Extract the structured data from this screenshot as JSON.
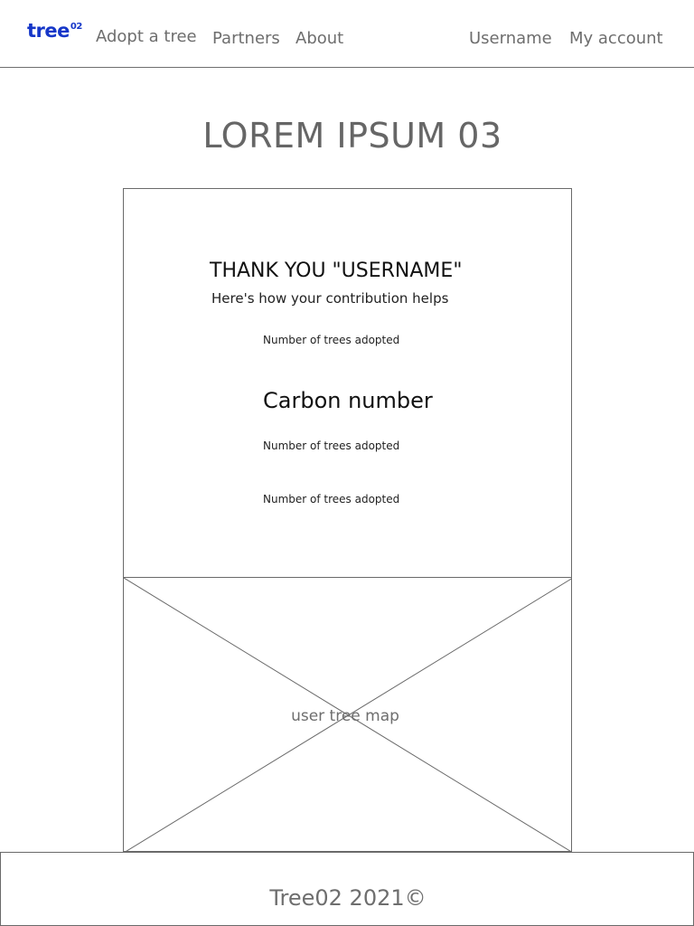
{
  "header": {
    "logo_text": "tree",
    "logo_superscript": "02",
    "nav": {
      "adopt": "Adopt a tree",
      "partners": "Partners",
      "about": "About",
      "username": "Username",
      "account": "My account"
    }
  },
  "main": {
    "title": "LOREM IPSUM 03",
    "card": {
      "heading": "THANK YOU \"USERNAME\"",
      "subheading": "Here's how your contribution helps",
      "stat_1": "Number of trees adopted",
      "carbon": "Carbon number",
      "stat_2": "Number of trees adopted",
      "stat_3": "Number of trees adopted"
    },
    "map": {
      "label": "user tree map"
    }
  },
  "footer": {
    "text": "Tree02 2021©"
  },
  "colors": {
    "brand": "#1536c8",
    "muted_text": "#6e6e6e",
    "border": "#6a6a6a"
  }
}
